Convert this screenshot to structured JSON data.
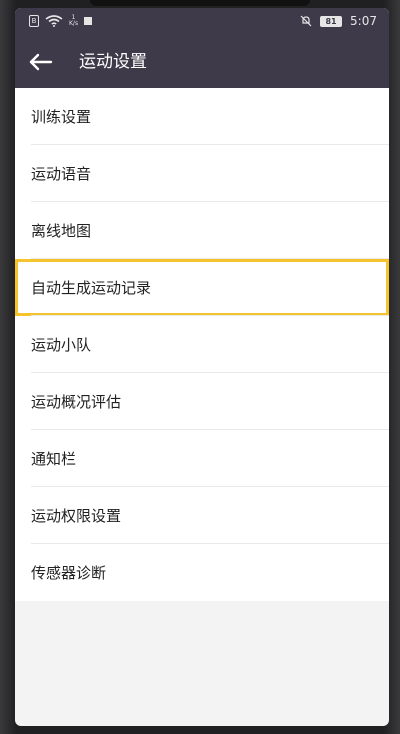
{
  "status_bar": {
    "sim_label": "B",
    "speed_value": "1",
    "speed_unit": "K/s",
    "battery": "81",
    "time": "5:07"
  },
  "app_bar": {
    "title": "运动设置"
  },
  "settings": {
    "items": [
      {
        "label": "训练设置"
      },
      {
        "label": "运动语音"
      },
      {
        "label": "离线地图"
      },
      {
        "label": "自动生成运动记录"
      },
      {
        "label": "运动小队"
      },
      {
        "label": "运动概况评估"
      },
      {
        "label": "通知栏"
      },
      {
        "label": "运动权限设置"
      },
      {
        "label": "传感器诊断"
      }
    ]
  },
  "colors": {
    "header_bg": "#3f3a4a",
    "highlight": "#f5c42c",
    "page_bg": "#f3f3f3"
  }
}
